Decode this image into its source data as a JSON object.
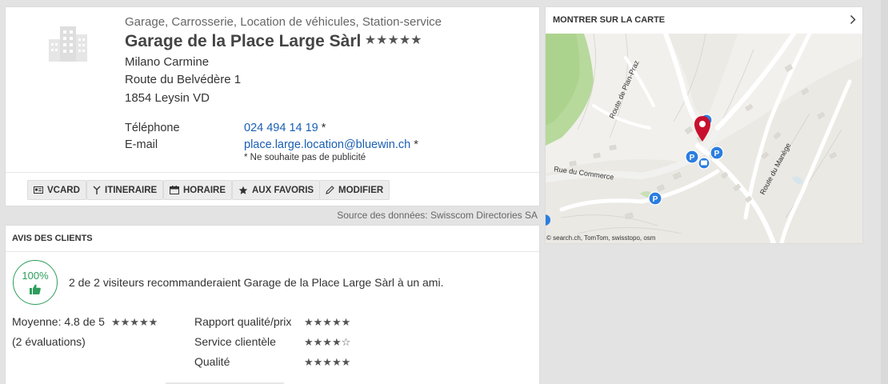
{
  "business": {
    "categories": "Garage, Carrosserie, Location de véhicules, Station-service",
    "name": "Garage de la Place Large Sàrl",
    "rating_stars": "★★★★★",
    "contact_person": "Milano Carmine",
    "street": "Route du Belvédère 1",
    "city": "1854 Leysin VD"
  },
  "contact": {
    "phone_label": "Téléphone",
    "phone": "024 494 14 19",
    "email_label": "E-mail",
    "email": "place.large.location@bluewin.ch",
    "asterisk": "*",
    "no_ads_note": "* Ne souhaite pas de publicité"
  },
  "actions": {
    "vcard": "VCARD",
    "itinerary": "ITINERAIRE",
    "hours": "HORAIRE",
    "favorites": "AUX FAVORIS",
    "edit": "MODIFIER"
  },
  "source": "Source des données: Swisscom Directories SA",
  "reviews": {
    "header": "AVIS DES CLIENTS",
    "recommend_pct": "100%",
    "recommend_text": "2 de 2 visiteurs recommanderaient Garage de la Place Large Sàrl à un ami.",
    "average": "Moyenne: 4.8 de 5",
    "average_stars": "★★★★★",
    "count": "(2 évaluations)",
    "criteria": [
      {
        "label": "Rapport qualité/prix",
        "stars": "★★★★★",
        "rating": 5
      },
      {
        "label": "Service clientèle",
        "stars": "★★★★☆",
        "rating": 4.5
      },
      {
        "label": "Qualité",
        "stars": "★★★★★",
        "rating": 5
      }
    ]
  },
  "map": {
    "header": "MONTRER SUR LA CARTE",
    "credit": "© search.ch, TomTom, swisstopo, osm",
    "streets": {
      "plan_praz": "Route de Plan-Praz",
      "commerce": "Rue du Commerce",
      "manege": "Route du Manège"
    }
  },
  "colors": {
    "link": "#1a5fb4",
    "recommend_green": "#2e9e5b",
    "marker_red": "#c8102e",
    "parking_blue": "#2b7de0"
  }
}
